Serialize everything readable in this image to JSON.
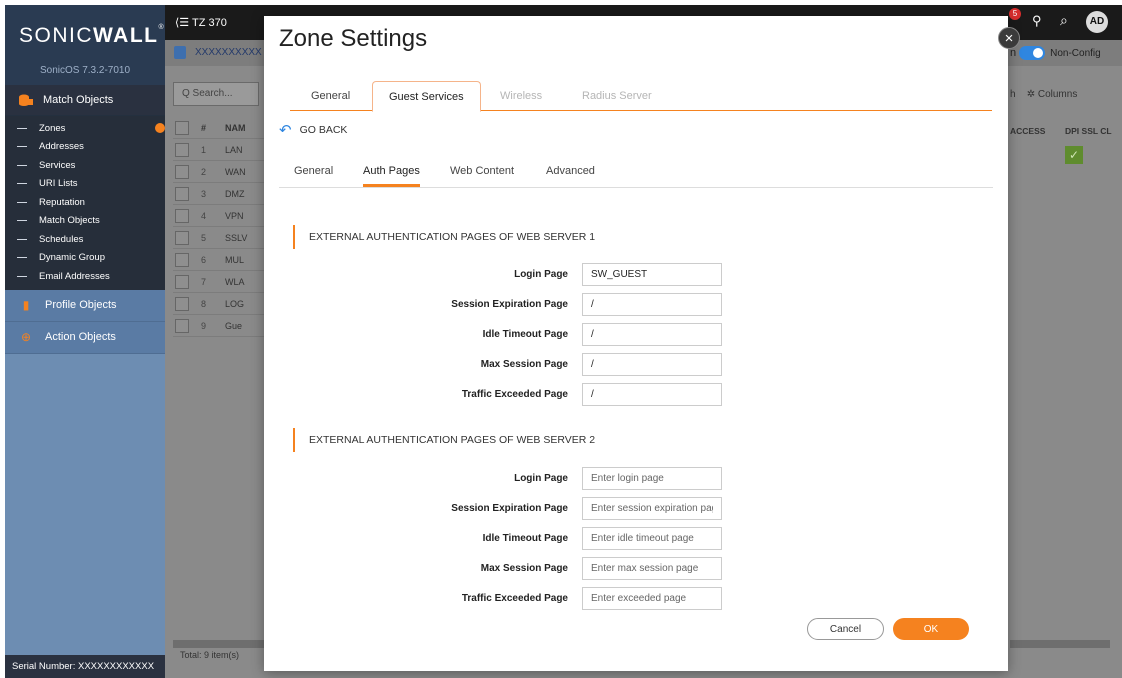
{
  "app": {
    "brand_main": "SONIC",
    "brand_bold": "WALL",
    "version": "SonicOS 7.3.2-7010",
    "serial": "Serial Number: XXXXXXXXXXXX"
  },
  "sidebar": {
    "match_objects": "Match Objects",
    "items": [
      "Zones",
      "Addresses",
      "Services",
      "URI Lists",
      "Reputation",
      "Match Objects",
      "Schedules",
      "Dynamic Group",
      "Email Addresses"
    ],
    "profile_objects": "Profile Objects",
    "action_objects": "Action Objects"
  },
  "background": {
    "device": "TZ 370",
    "breadcrumb": "XXXXXXXXXX",
    "search_placeholder": "Q  Search...",
    "table_header_num": "#",
    "table_header_name": "NAM",
    "rows": [
      {
        "num": "1",
        "name": "LAN"
      },
      {
        "num": "2",
        "name": "WAN"
      },
      {
        "num": "3",
        "name": "DMZ"
      },
      {
        "num": "4",
        "name": "VPN"
      },
      {
        "num": "5",
        "name": "SSLV"
      },
      {
        "num": "6",
        "name": "MUL"
      },
      {
        "num": "7",
        "name": "WLA"
      },
      {
        "num": "8",
        "name": "LOG"
      },
      {
        "num": "9",
        "name": "Gue"
      }
    ],
    "total": "Total: 9 item(s)",
    "refresh_fragment": "h",
    "columns_label": "Columns",
    "col_access": "ACCESS",
    "col_dpi": "DPI SSL CL",
    "notif_count": "5",
    "avatar": "AD",
    "toggle_prefix": "n",
    "toggle_label": "Non-Config"
  },
  "modal": {
    "title": "Zone Settings",
    "tabs": [
      "General",
      "Guest Services",
      "Wireless",
      "Radius Server"
    ],
    "go_back": "GO BACK",
    "sub_tabs": [
      "General",
      "Auth Pages",
      "Web Content",
      "Advanced"
    ],
    "section1": {
      "title": "EXTERNAL AUTHENTICATION PAGES OF WEB SERVER 1",
      "fields": [
        {
          "label": "Login Page",
          "value": "SW_GUEST"
        },
        {
          "label": "Session Expiration Page",
          "value": "/"
        },
        {
          "label": "Idle Timeout Page",
          "value": "/"
        },
        {
          "label": "Max Session Page",
          "value": "/"
        },
        {
          "label": "Traffic Exceeded Page",
          "value": "/"
        }
      ]
    },
    "section2": {
      "title": "EXTERNAL AUTHENTICATION PAGES OF WEB SERVER 2",
      "fields": [
        {
          "label": "Login Page",
          "placeholder": "Enter login page"
        },
        {
          "label": "Session Expiration Page",
          "placeholder": "Enter session expiration page"
        },
        {
          "label": "Idle Timeout Page",
          "placeholder": "Enter idle timeout page"
        },
        {
          "label": "Max Session Page",
          "placeholder": "Enter max session page"
        },
        {
          "label": "Traffic Exceeded Page",
          "placeholder": "Enter exceeded page"
        }
      ]
    },
    "cancel": "Cancel",
    "ok": "OK"
  },
  "colors": {
    "accent": "#f5821f",
    "sidebar_dark": "#2a3140",
    "sidebar_light": "#6d8db2",
    "toggle": "#2f86e0"
  }
}
